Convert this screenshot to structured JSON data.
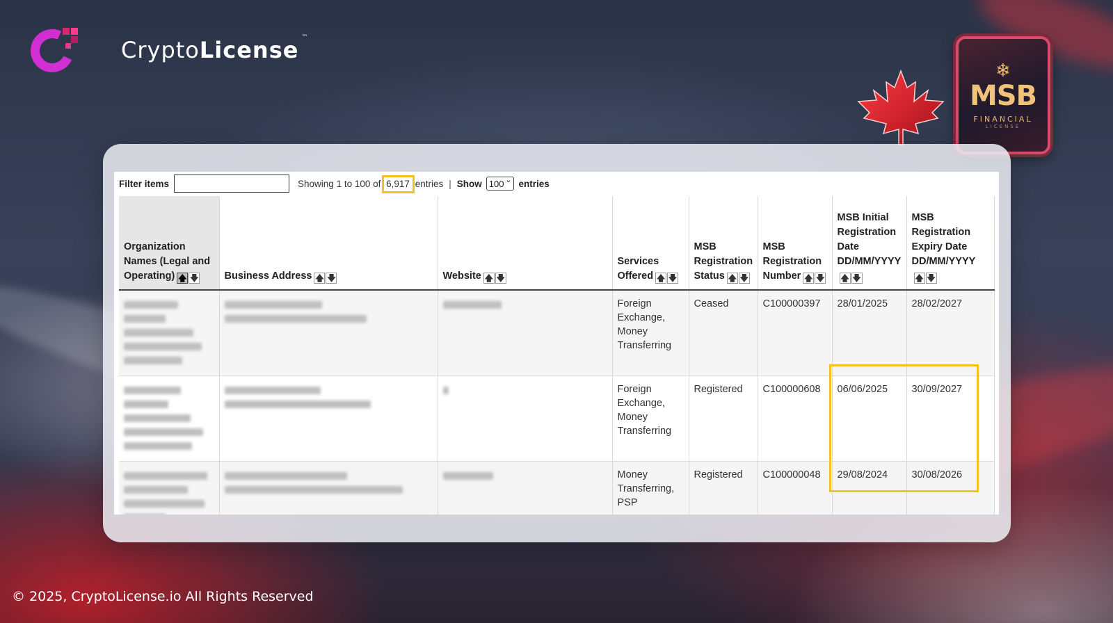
{
  "brand": {
    "name_light": "Crypto",
    "name_bold": "License",
    "trademark": "™"
  },
  "badge": {
    "title": "MSB",
    "line1": "FINANCIAL",
    "line2": "LICENSE"
  },
  "controls": {
    "filter_label": "Filter items",
    "filter_value": "",
    "showing_prefix": "Showing 1 to 100 of",
    "total_entries": "6,917",
    "showing_suffix": "entries",
    "separator": "|",
    "show_label": "Show",
    "page_size": "100",
    "entries_label": "entries"
  },
  "table": {
    "headers": [
      "Organization Names (Legal and Operating)",
      "Business Address",
      "Website",
      "Services Offered",
      "MSB Registration Status",
      "MSB Registration Number",
      "MSB Initial Registration Date DD/MM/YYYY",
      "MSB Registration Expiry Date DD/MM/YYYY"
    ],
    "rows": [
      {
        "services": [
          "Foreign Exchange,",
          "Money",
          "Transferring"
        ],
        "status": "Ceased",
        "number": "C100000397",
        "initial_date": "28/01/2025",
        "expiry_date": "28/02/2027"
      },
      {
        "services": [
          "Foreign Exchange,",
          "Money",
          "Transferring"
        ],
        "status": "Registered",
        "number": "C100000608",
        "initial_date": "06/06/2025",
        "expiry_date": "30/09/2027"
      },
      {
        "services": [
          "Money",
          "Transferring,",
          "PSP"
        ],
        "status": "Registered",
        "number": "C100000048",
        "initial_date": "29/08/2024",
        "expiry_date": "30/08/2026"
      }
    ]
  },
  "footer": {
    "copyright": "© 2025, CryptoLicense.io All Rights Reserved"
  },
  "colors": {
    "highlight": "#f5c21b",
    "brand_magenta": "#d12fd4",
    "maple_red": "#e0202f"
  }
}
